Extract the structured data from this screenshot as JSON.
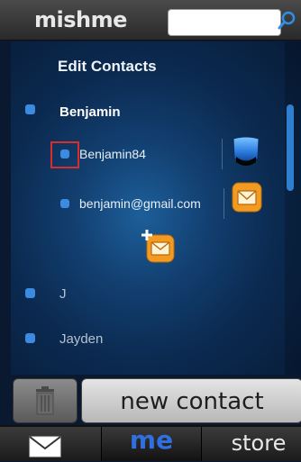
{
  "app": {
    "logo_text": "mishme"
  },
  "search": {
    "placeholder": ""
  },
  "panel": {
    "title": "Edit Contacts",
    "contacts": [
      {
        "name": "Benjamin",
        "details": [
          "Benjamin84",
          "benjamin@gmail.com"
        ]
      },
      {
        "name": "J"
      },
      {
        "name": "Jayden"
      }
    ]
  },
  "buttons": {
    "new_contact_label": "new contact"
  },
  "tabs": {
    "me_label": "me",
    "store_label": "store"
  },
  "colors": {
    "accent_blue": "#3d8be0",
    "highlight_red": "#d92c2c",
    "mail_orange": "#f29a22",
    "tab_me_blue": "#2f6fe0"
  }
}
